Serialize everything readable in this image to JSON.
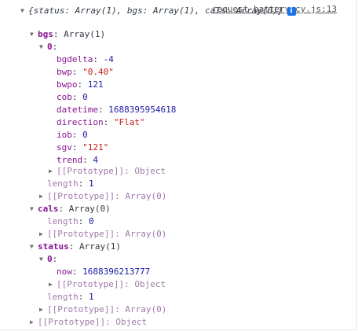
{
  "source_link": "request-battery.cy.js:13",
  "root": {
    "summary": "{status: Array(1), bgs: Array(1), cals: Array(0)}",
    "info_icon": "info-icon"
  },
  "bgs": {
    "key": "bgs",
    "type": "Array(1)",
    "item_key": "0",
    "props": [
      {
        "key": "bgdelta",
        "value": "-4",
        "kind": "num"
      },
      {
        "key": "bwp",
        "value": "\"0.40\"",
        "kind": "str"
      },
      {
        "key": "bwpo",
        "value": "121",
        "kind": "num"
      },
      {
        "key": "cob",
        "value": "0",
        "kind": "num"
      },
      {
        "key": "datetime",
        "value": "1688395954618",
        "kind": "num"
      },
      {
        "key": "direction",
        "value": "\"Flat\"",
        "kind": "str"
      },
      {
        "key": "iob",
        "value": "0",
        "kind": "num"
      },
      {
        "key": "sgv",
        "value": "\"121\"",
        "kind": "str"
      },
      {
        "key": "trend",
        "value": "4",
        "kind": "num"
      }
    ],
    "item_proto": "[[Prototype]]: Object",
    "length_key": "length",
    "length_value": "1",
    "proto": "[[Prototype]]: Array(0)"
  },
  "cals": {
    "key": "cals",
    "type": "Array(0)",
    "length_key": "length",
    "length_value": "0",
    "proto": "[[Prototype]]: Array(0)"
  },
  "status": {
    "key": "status",
    "type": "Array(1)",
    "item_key": "0",
    "now_key": "now",
    "now_value": "1688396213777",
    "item_proto": "[[Prototype]]: Object",
    "length_key": "length",
    "length_value": "1",
    "proto": "[[Prototype]]: Array(0)"
  },
  "root_proto": "[[Prototype]]: Object"
}
